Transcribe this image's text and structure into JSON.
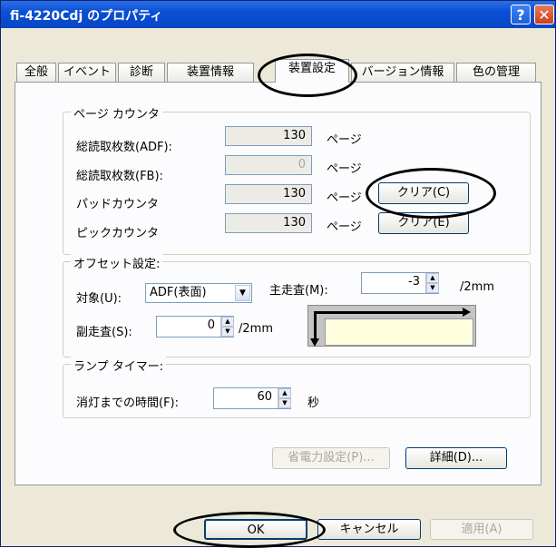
{
  "window": {
    "title": "fi-4220Cdj のプロパティ",
    "help_label": "?",
    "close_label": "✕"
  },
  "tabs": [
    "全般",
    "イベント",
    "診断",
    "装置情報",
    "装置設定",
    "バージョン情報",
    "色の管理"
  ],
  "active_tab": "装置設定",
  "page_counter": {
    "legend": "ページ カウンタ",
    "rows": [
      {
        "label": "総読取枚数(ADF):",
        "value": "130",
        "unit": "ページ"
      },
      {
        "label": "総読取枚数(FB):",
        "value": "0",
        "unit": "ページ"
      },
      {
        "label": "パッドカウンタ",
        "value": "130",
        "unit": "ページ",
        "button": "クリア(C)"
      },
      {
        "label": "ピックカウンタ",
        "value": "130",
        "unit": "ページ",
        "button": "クリア(E)"
      }
    ]
  },
  "offset": {
    "legend": "オフセット設定:",
    "target_label": "対象(U):",
    "target_value": "ADF(表面)",
    "main_scan_label": "主走査(M):",
    "main_scan_value": "-3",
    "sub_scan_label": "副走査(S):",
    "sub_scan_value": "0",
    "unit": "/2mm"
  },
  "lamp": {
    "legend": "ランプ タイマー:",
    "label": "消灯までの時間(F):",
    "value": "60",
    "unit": "秒"
  },
  "buttons": {
    "power_save": "省電力設定(P)...",
    "detail": "詳細(D)...",
    "ok": "OK",
    "cancel": "キャンセル",
    "apply": "適用(A)"
  }
}
